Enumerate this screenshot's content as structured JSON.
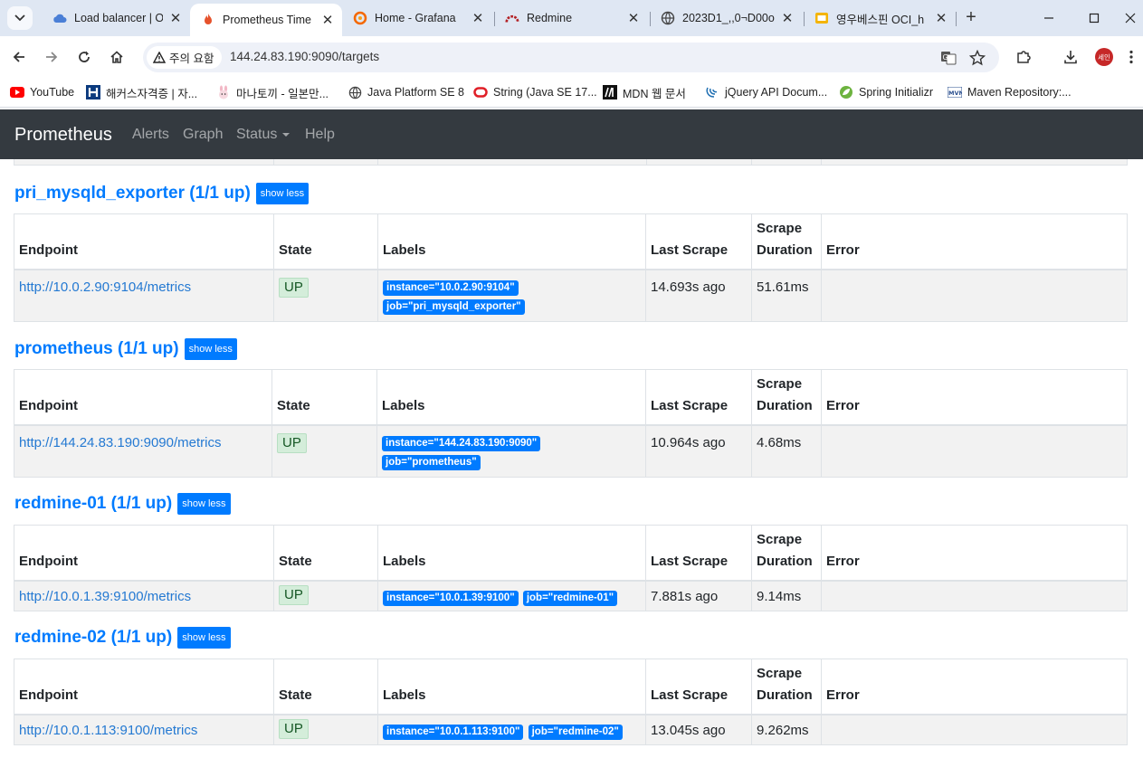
{
  "browser": {
    "tabs": [
      {
        "title": "Load balancer | Ot",
        "icon": "cloud-icon",
        "active": false
      },
      {
        "title": "Prometheus Time",
        "icon": "prometheus-flame-icon",
        "active": true
      },
      {
        "title": "Home - Grafana",
        "icon": "grafana-icon",
        "active": false
      },
      {
        "title": "Redmine",
        "icon": "redmine-icon",
        "active": false
      },
      {
        "title": "2023D1_,,0¬D00o",
        "icon": "globe-icon",
        "active": false
      },
      {
        "title": "영우베스핀 OCI_h",
        "icon": "slides-icon",
        "active": false
      }
    ],
    "security_label": "주의 요함",
    "url": "144.24.83.190:9090/targets",
    "profile_label": "세인",
    "bookmarks": [
      {
        "label": "YouTube",
        "icon": "youtube-icon"
      },
      {
        "label": "해커스자격증 | 자...",
        "icon": "hackers-icon"
      },
      {
        "label": "마나토끼 - 일본만...",
        "icon": "rabbit-icon"
      },
      {
        "label": "Java Platform SE 8",
        "icon": "globe-icon"
      },
      {
        "label": "String (Java SE 17...",
        "icon": "oracle-icon"
      },
      {
        "label": "MDN 웹 문서",
        "icon": "mdn-icon"
      },
      {
        "label": "jQuery API Docum...",
        "icon": "jquery-icon"
      },
      {
        "label": "Spring Initializr",
        "icon": "spring-icon"
      },
      {
        "label": "Maven Repository:...",
        "icon": "maven-icon"
      }
    ]
  },
  "nav": {
    "brand": "Prometheus",
    "alerts": "Alerts",
    "graph": "Graph",
    "status": "Status",
    "help": "Help"
  },
  "columns": {
    "endpoint": "Endpoint",
    "state": "State",
    "labels": "Labels",
    "last_scrape": "Last Scrape",
    "scrape": "Scrape",
    "duration": "Duration",
    "error": "Error"
  },
  "show_less": "show less",
  "sections": [
    {
      "title": "pri_mysqld_exporter (1/1 up)",
      "endpoint": "http://10.0.2.90:9104/metrics",
      "state": "UP",
      "labels": [
        "instance=\"10.0.2.90:9104\"",
        "job=\"pri_mysqld_exporter\""
      ],
      "last_scrape": "14.693s ago",
      "duration": "51.61ms",
      "error": ""
    },
    {
      "title": "prometheus (1/1 up)",
      "endpoint": "http://144.24.83.190:9090/metrics",
      "state": "UP",
      "labels": [
        "instance=\"144.24.83.190:9090\"",
        "job=\"prometheus\""
      ],
      "last_scrape": "10.964s ago",
      "duration": "4.68ms",
      "error": ""
    },
    {
      "title": "redmine-01 (1/1 up)",
      "endpoint": "http://10.0.1.39:9100/metrics",
      "state": "UP",
      "labels": [
        "instance=\"10.0.1.39:9100\"",
        "job=\"redmine-01\""
      ],
      "last_scrape": "7.881s ago",
      "duration": "9.14ms",
      "error": ""
    },
    {
      "title": "redmine-02 (1/1 up)",
      "endpoint": "http://10.0.1.113:9100/metrics",
      "state": "UP",
      "labels": [
        "instance=\"10.0.1.113:9100\"",
        "job=\"redmine-02\""
      ],
      "last_scrape": "13.045s ago",
      "duration": "9.262ms",
      "error": ""
    }
  ]
}
